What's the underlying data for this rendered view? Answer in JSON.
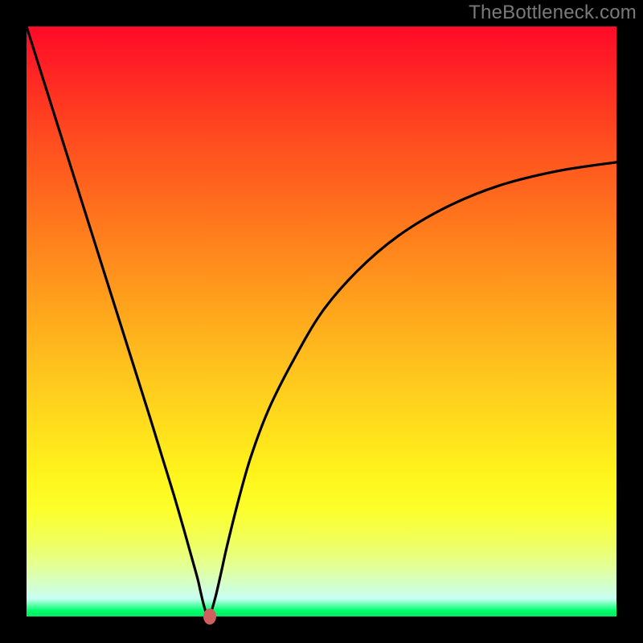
{
  "watermark": "TheBottleneck.com",
  "chart_data": {
    "type": "line",
    "title": "",
    "xlabel": "",
    "ylabel": "",
    "xlim": [
      0,
      100
    ],
    "ylim": [
      0,
      100
    ],
    "x": [
      0,
      3,
      6,
      9,
      12,
      15,
      18,
      21,
      23,
      25,
      26.8,
      28,
      29,
      29.5,
      30,
      30.5,
      31,
      32,
      33,
      34,
      36,
      38,
      41,
      45,
      50,
      56,
      63,
      71,
      80,
      90,
      100
    ],
    "y": [
      100,
      90.5,
      81,
      71.5,
      62,
      52.5,
      43,
      33.5,
      27,
      20.5,
      14.3,
      10,
      6.4,
      4.2,
      2.1,
      0.5,
      0,
      3.2,
      7.5,
      12,
      20,
      27,
      35,
      43,
      51.5,
      58.5,
      64.5,
      69.3,
      73,
      75.5,
      77
    ],
    "marker": {
      "x": 31,
      "y": 0
    },
    "legend": null
  },
  "colors": {
    "frame": "#000000",
    "marker": "#d06060",
    "curve": "#000000",
    "gradient_top": "#ff0a27",
    "gradient_bottom": "#00e863"
  }
}
